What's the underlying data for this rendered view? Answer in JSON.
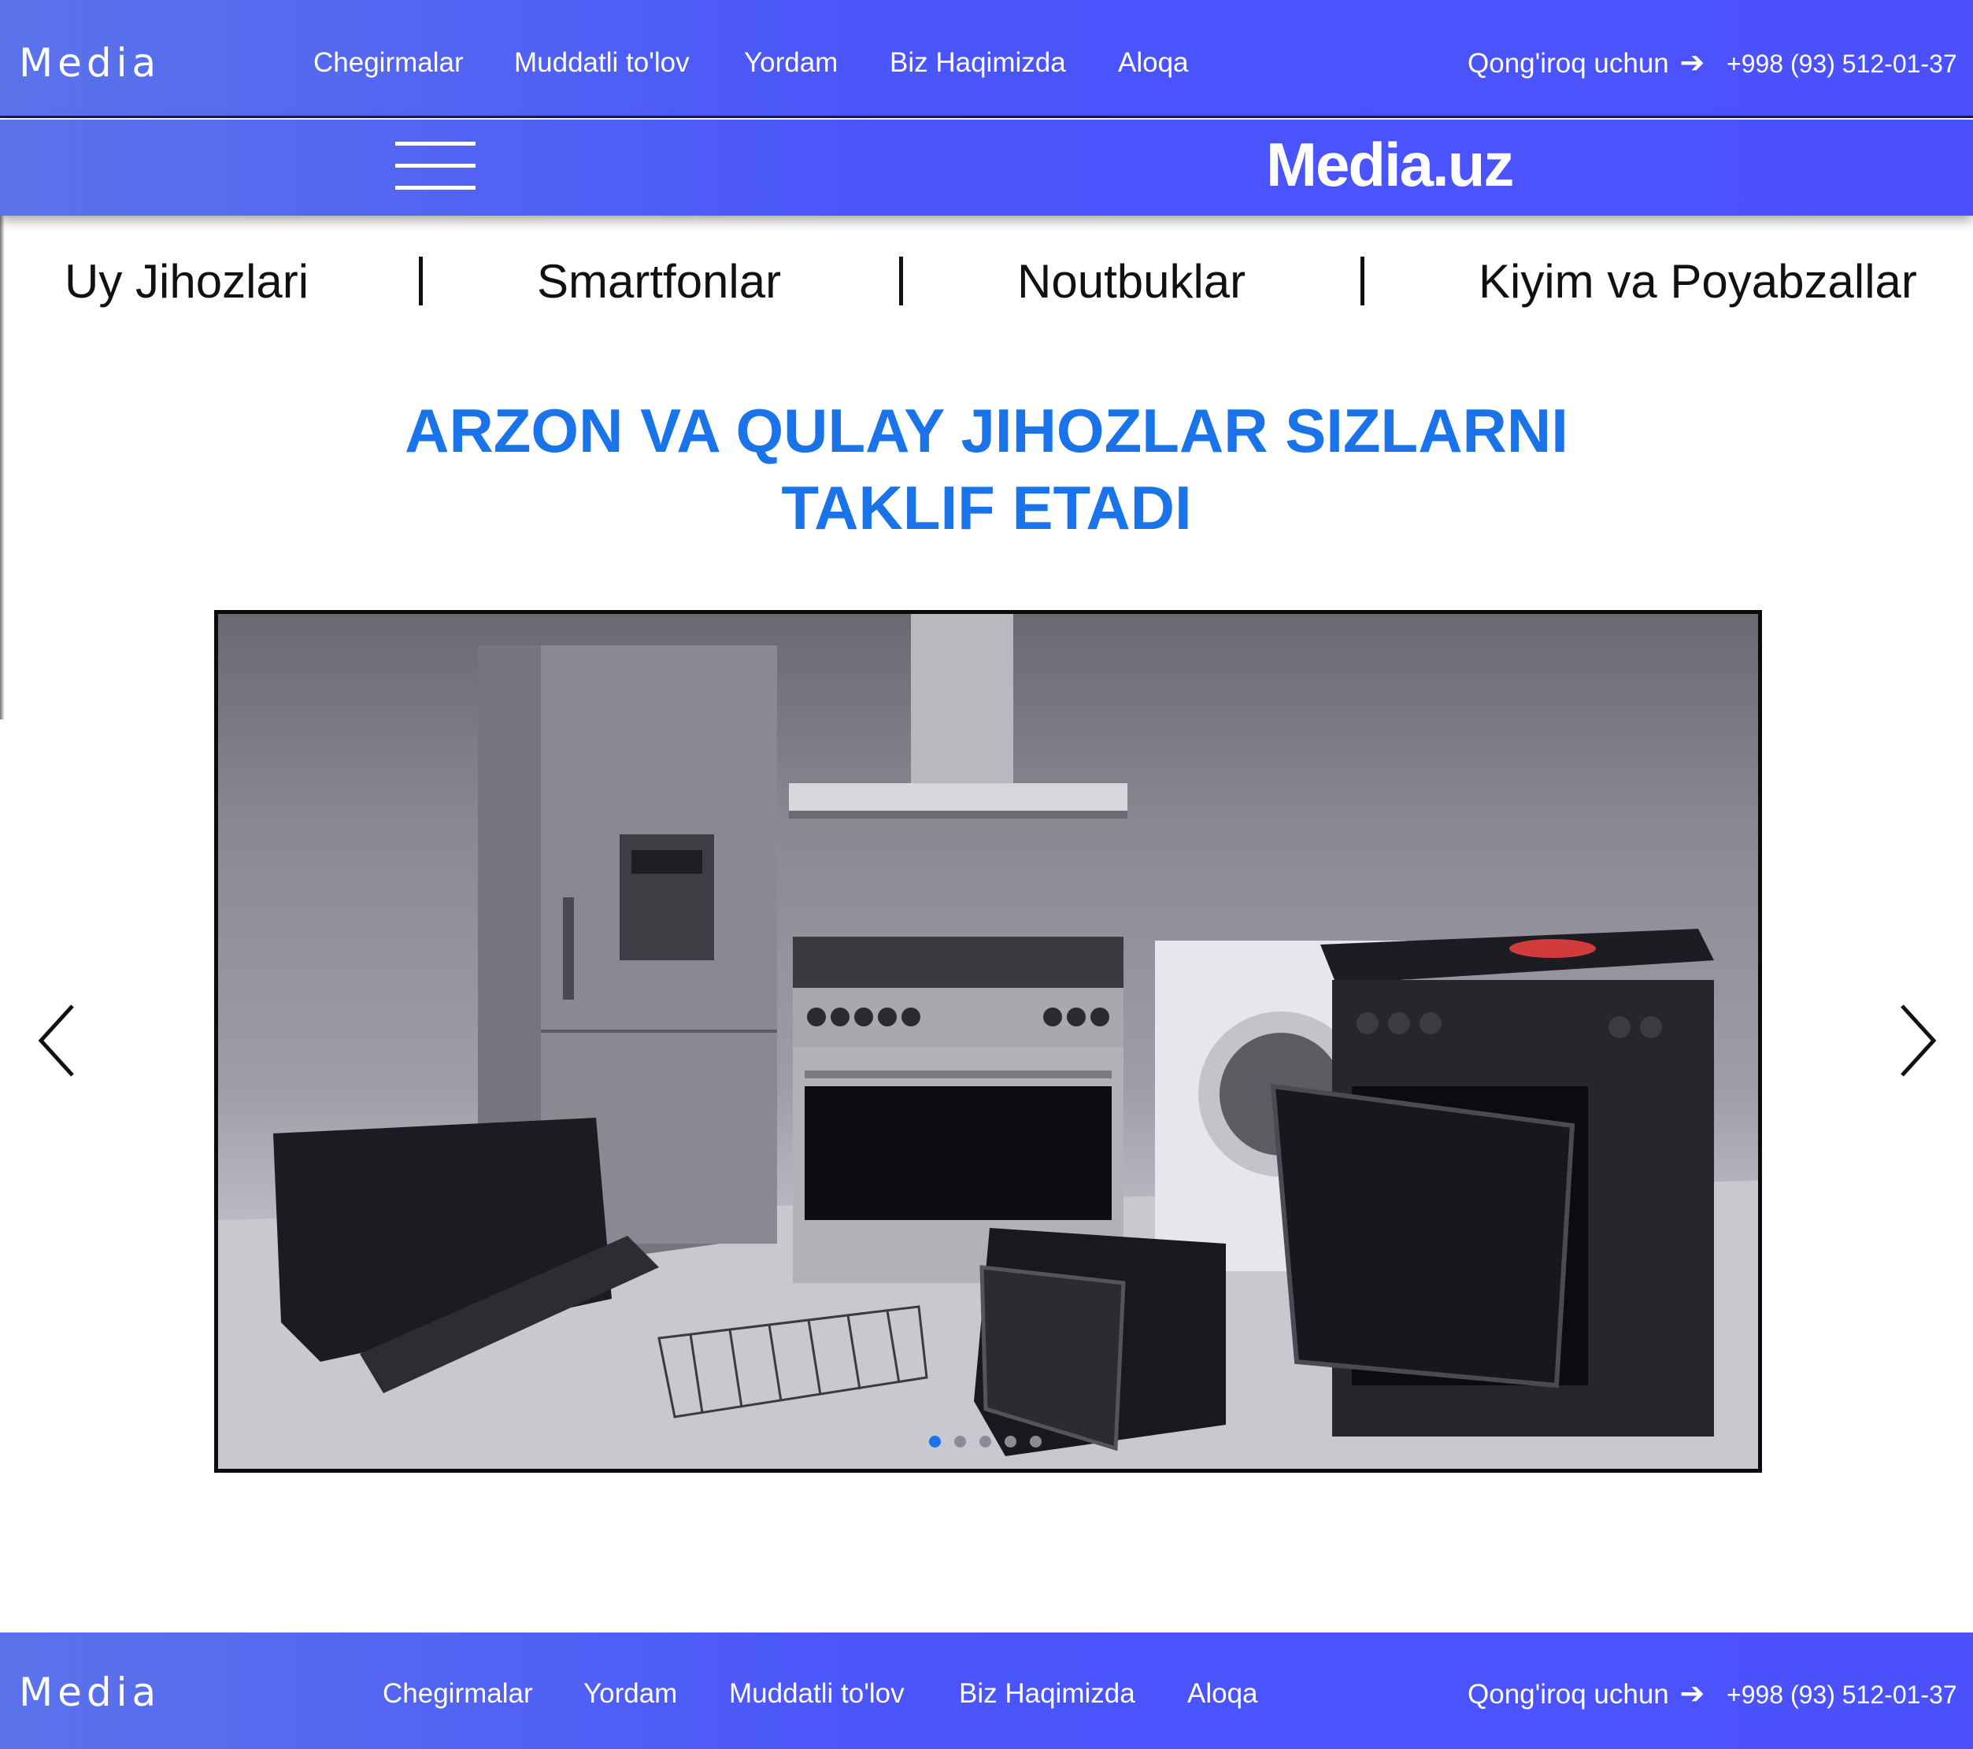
{
  "header": {
    "brand": "Media",
    "nav": [
      "Chegirmalar",
      "Muddatli to'lov",
      "Yordam",
      "Biz Haqimizda",
      "Aloqa"
    ],
    "call_label": "Qong'iroq uchun",
    "phone": "+998 (93) 512-01-37"
  },
  "subheader": {
    "logo": "Media.uz"
  },
  "categories": [
    "Uy Jihozlari",
    "Smartfonlar",
    "Noutbuklar",
    "Kiyim va Poyabzallar"
  ],
  "hero": {
    "title_line1": "ARZON VA QULAY JIHOZLAR SIZLARNI",
    "title_line2": "TAKLIF ETADI"
  },
  "carousel": {
    "slide_count": 5,
    "active_index": 0,
    "prev_icon": "chevron-left-icon",
    "next_icon": "chevron-right-icon"
  },
  "footer": {
    "brand": "Media",
    "nav": [
      "Chegirmalar",
      "Yordam",
      "Muddatli to'lov",
      "Biz Haqimizda",
      "Aloqa"
    ],
    "call_label": "Qong'iroq uchun",
    "phone": "+998 (93) 512-01-37"
  },
  "colors": {
    "bar_gradient_start": "#5b73ea",
    "bar_gradient_end": "#4b52fd",
    "heading_blue": "#1a73e8",
    "active_dot": "#1a73e8"
  }
}
